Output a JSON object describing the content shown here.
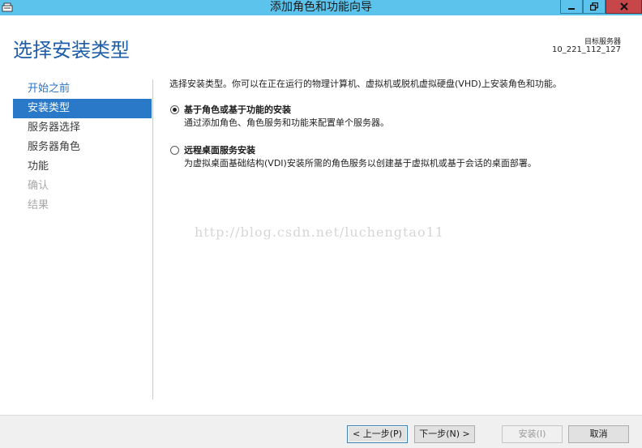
{
  "window": {
    "title": "添加角色和功能向导"
  },
  "header": {
    "page_title": "选择安装类型",
    "target_label": "目标服务器",
    "target_value": "10_221_112_127"
  },
  "nav": {
    "items": [
      {
        "label": "开始之前",
        "state": "link"
      },
      {
        "label": "安装类型",
        "state": "active"
      },
      {
        "label": "服务器选择",
        "state": "normal"
      },
      {
        "label": "服务器角色",
        "state": "normal"
      },
      {
        "label": "功能",
        "state": "normal"
      },
      {
        "label": "确认",
        "state": "disabled"
      },
      {
        "label": "结果",
        "state": "disabled"
      }
    ]
  },
  "content": {
    "intro": "选择安装类型。你可以在正在运行的物理计算机、虚拟机或脱机虚拟硬盘(VHD)上安装角色和功能。",
    "options": [
      {
        "title": "基于角色或基于功能的安装",
        "desc": "通过添加角色、角色服务和功能来配置单个服务器。",
        "checked": true
      },
      {
        "title": "远程桌面服务安装",
        "desc": "为虚拟桌面基础结构(VDI)安装所需的角色服务以创建基于虚拟机或基于会话的桌面部署。",
        "checked": false
      }
    ]
  },
  "watermark": "http://blog.csdn.net/luchengtao11",
  "footer": {
    "prev": "< 上一步(P)",
    "next": "下一步(N) >",
    "install": "安装(I)",
    "cancel": "取消"
  },
  "colors": {
    "titlebar": "#5cc4ec",
    "accent": "#2a78c8",
    "close": "#c7464a"
  }
}
